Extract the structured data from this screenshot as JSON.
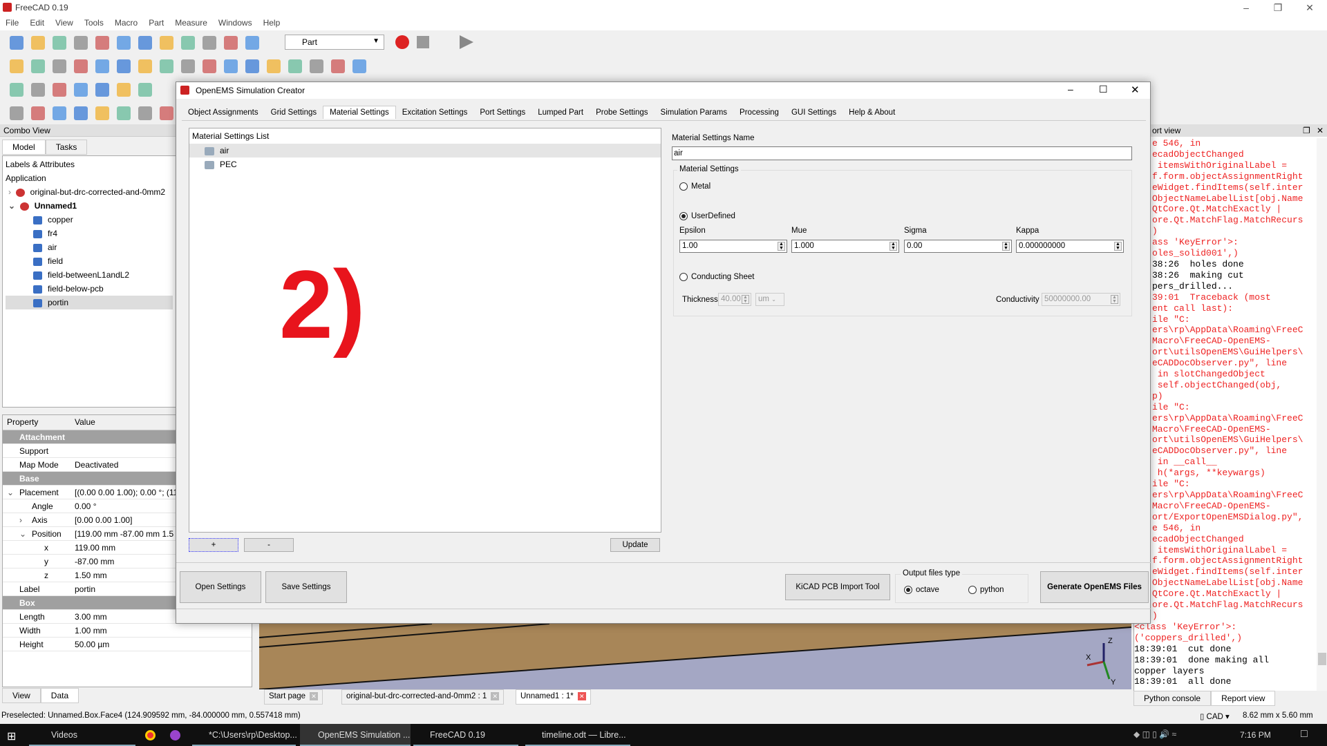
{
  "app": {
    "title": "FreeCAD 0.19",
    "menu": [
      "File",
      "Edit",
      "View",
      "Tools",
      "Macro",
      "Part",
      "Measure",
      "Windows",
      "Help"
    ],
    "workbench": "Part"
  },
  "combo": {
    "title": "Combo View",
    "tabs": [
      "Model",
      "Tasks"
    ],
    "labels_header": "Labels & Attributes",
    "application": "Application",
    "docs": [
      {
        "label": "original-but-drc-corrected-and-0mm2",
        "expanded": false
      },
      {
        "label": "Unnamed1",
        "expanded": true
      }
    ],
    "items": [
      "copper",
      "fr4",
      "air",
      "field",
      "field-betweenL1andL2",
      "field-below-pcb",
      "portin"
    ],
    "selected": "portin"
  },
  "properties": {
    "header": [
      "Property",
      "Value"
    ],
    "rows": [
      {
        "k": "Attachment",
        "v": "",
        "group": true
      },
      {
        "k": "Support",
        "v": ""
      },
      {
        "k": "Map Mode",
        "v": "Deactivated"
      },
      {
        "k": "Base",
        "v": "",
        "group": true
      },
      {
        "k": "Placement",
        "v": "[(0.00 0.00 1.00); 0.00 °; (119.",
        "exp": "v"
      },
      {
        "k": "Angle",
        "v": "0.00 °",
        "ind": 1
      },
      {
        "k": "Axis",
        "v": "[0.00 0.00 1.00]",
        "ind": 1,
        "exp": ">"
      },
      {
        "k": "Position",
        "v": "[119.00 mm  -87.00 mm  1.5",
        "ind": 1,
        "exp": "v"
      },
      {
        "k": "x",
        "v": "119.00 mm",
        "ind": 2
      },
      {
        "k": "y",
        "v": "-87.00 mm",
        "ind": 2
      },
      {
        "k": "z",
        "v": "1.50 mm",
        "ind": 2
      },
      {
        "k": "Label",
        "v": "portin"
      },
      {
        "k": "Box",
        "v": "",
        "group": true
      },
      {
        "k": "Length",
        "v": "3.00 mm"
      },
      {
        "k": "Width",
        "v": "1.00 mm"
      },
      {
        "k": "Height",
        "v": "50.00 µm"
      }
    ],
    "tabs": [
      "View",
      "Data"
    ]
  },
  "dialog": {
    "title": "OpenEMS Simulation Creator",
    "tabs": [
      "Object Assignments",
      "Grid Settings",
      "Material Settings",
      "Excitation Settings",
      "Port Settings",
      "Lumped Part",
      "Probe Settings",
      "Simulation Params",
      "Processing",
      "GUI Settings",
      "Help & About"
    ],
    "active_tab": "Material Settings",
    "list_title": "Material Settings List",
    "list": [
      "air",
      "PEC"
    ],
    "selected": "air",
    "add": "+",
    "remove": "-",
    "update": "Update",
    "annotation": "2)",
    "name_label": "Material Settings Name",
    "name_value": "air",
    "group_label": "Material Settings",
    "metal": "Metal",
    "userdefined": "UserDefined",
    "selected_type": "UserDefined",
    "epsilon_label": "Epsilon",
    "epsilon": "1.00",
    "mue_label": "Mue",
    "mue": "1.000",
    "sigma_label": "Sigma",
    "sigma": "0.00",
    "kappa_label": "Kappa",
    "kappa": "0.000000000",
    "conducting": "Conducting Sheet",
    "thickness_label": "Thickness",
    "thickness": "40.00",
    "thickness_unit": "um",
    "conductivity_label": "Conductivity",
    "conductivity": "50000000.00",
    "open_settings": "Open Settings",
    "save_settings": "Save Settings",
    "kicad": "KiCAD PCB Import Tool",
    "output_label": "Output files type",
    "octave": "octave",
    "python": "python",
    "output_selected": "octave",
    "generate": "Generate OpenEMS Files"
  },
  "report": {
    "title": "ort view",
    "lines": [
      {
        "t": "e 546, in",
        "e": 1
      },
      {
        "t": "ecadObjectChanged",
        "e": 1
      },
      {
        "t": " itemsWithOriginalLabel =",
        "e": 1
      },
      {
        "t": "f.form.objectAssignmentRight",
        "e": 1
      },
      {
        "t": "eWidget.findItems(self.inter",
        "e": 1
      },
      {
        "t": "ObjectNameLabelList[obj.Name",
        "e": 1
      },
      {
        "t": "QtCore.Qt.MatchExactly |",
        "e": 1
      },
      {
        "t": "ore.Qt.MatchFlag.MatchRecurs",
        "e": 1
      },
      {
        "t": ")",
        "e": 1
      },
      {
        "t": "ass 'KeyError'>:",
        "e": 1
      },
      {
        "t": "oles_solid001',)",
        "e": 1
      },
      {
        "t": "38:26  holes done",
        "e": 0
      },
      {
        "t": "38:26  making cut",
        "e": 0
      },
      {
        "t": "pers_drilled...",
        "e": 0
      },
      {
        "t": "39:01  Traceback (most",
        "e": 1
      },
      {
        "t": "ent call last):",
        "e": 1
      },
      {
        "t": "ile \"C:",
        "e": 1
      },
      {
        "t": "ers\\rp\\AppData\\Roaming\\FreeC",
        "e": 1
      },
      {
        "t": "Macro\\FreeCAD-OpenEMS-",
        "e": 1
      },
      {
        "t": "ort\\utilsOpenEMS\\GuiHelpers\\",
        "e": 1
      },
      {
        "t": "eCADDocObserver.py\", line",
        "e": 1
      },
      {
        "t": " in slotChangedObject",
        "e": 1
      },
      {
        "t": " self.objectChanged(obj,",
        "e": 1
      },
      {
        "t": "p)",
        "e": 1
      },
      {
        "t": "ile \"C:",
        "e": 1
      },
      {
        "t": "ers\\rp\\AppData\\Roaming\\FreeC",
        "e": 1
      },
      {
        "t": "Macro\\FreeCAD-OpenEMS-",
        "e": 1
      },
      {
        "t": "ort\\utilsOpenEMS\\GuiHelpers\\",
        "e": 1
      },
      {
        "t": "eCADDocObserver.py\", line",
        "e": 1
      },
      {
        "t": " in __call__",
        "e": 1
      },
      {
        "t": " h(*args, **keywargs)",
        "e": 1
      },
      {
        "t": "ile \"C:",
        "e": 1
      },
      {
        "t": "ers\\rp\\AppData\\Roaming\\FreeC",
        "e": 1
      },
      {
        "t": "Macro\\FreeCAD-OpenEMS-",
        "e": 1
      },
      {
        "t": "ort/ExportOpenEMSDialog.py\",",
        "e": 1
      },
      {
        "t": "e 546, in",
        "e": 1
      },
      {
        "t": "ecadObjectChanged",
        "e": 1
      },
      {
        "t": " itemsWithOriginalLabel =",
        "e": 1
      },
      {
        "t": "f.form.objectAssignmentRight",
        "e": 1
      },
      {
        "t": "eWidget.findItems(self.inter",
        "e": 1
      },
      {
        "t": "ObjectNameLabelList[obj.Name",
        "e": 1
      },
      {
        "t": "QtCore.Qt.MatchExactly |",
        "e": 1
      },
      {
        "t": "ore.Qt.MatchFlag.MatchRecurs",
        "e": 1
      },
      {
        "t": ")",
        "e": 1
      },
      {
        "t": "<class 'KeyError'>:",
        "e": 1,
        "full": 1
      },
      {
        "t": "('coppers_drilled',)",
        "e": 1,
        "full": 1
      },
      {
        "t": "18:39:01  cut done",
        "e": 0,
        "full": 1
      },
      {
        "t": "18:39:01  done making all",
        "e": 0,
        "full": 1
      },
      {
        "t": "copper layers",
        "e": 0,
        "full": 1
      },
      {
        "t": "18:39:01  all done",
        "e": 0,
        "full": 1
      }
    ],
    "tabs": [
      "Python console",
      "Report view"
    ]
  },
  "view_tabs": [
    "Start page",
    "original-but-drc-corrected-and-0mm2 : 1",
    "Unnamed1 : 1*"
  ],
  "axes": {
    "x": "X",
    "y": "Y",
    "z": "Z"
  },
  "status": {
    "text": "Preselected: Unnamed.Box.Face4 (124.909592 mm, -84.000000 mm, 0.557418 mm)",
    "nav": "CAD",
    "dims": "8.62 mm x 5.60 mm"
  },
  "taskbar": {
    "items": [
      "Videos",
      "*C:\\Users\\rp\\Desktop...",
      "OpenEMS Simulation ...",
      "FreeCAD 0.19",
      "timeline.odt — Libre..."
    ],
    "active": "OpenEMS Simulation ...",
    "clock": "7:16 PM"
  },
  "colors": {
    "annotation": "#e8141c",
    "report_error": "#e22222",
    "pcb": "#a88658",
    "background3d": "#a4a7c4"
  }
}
